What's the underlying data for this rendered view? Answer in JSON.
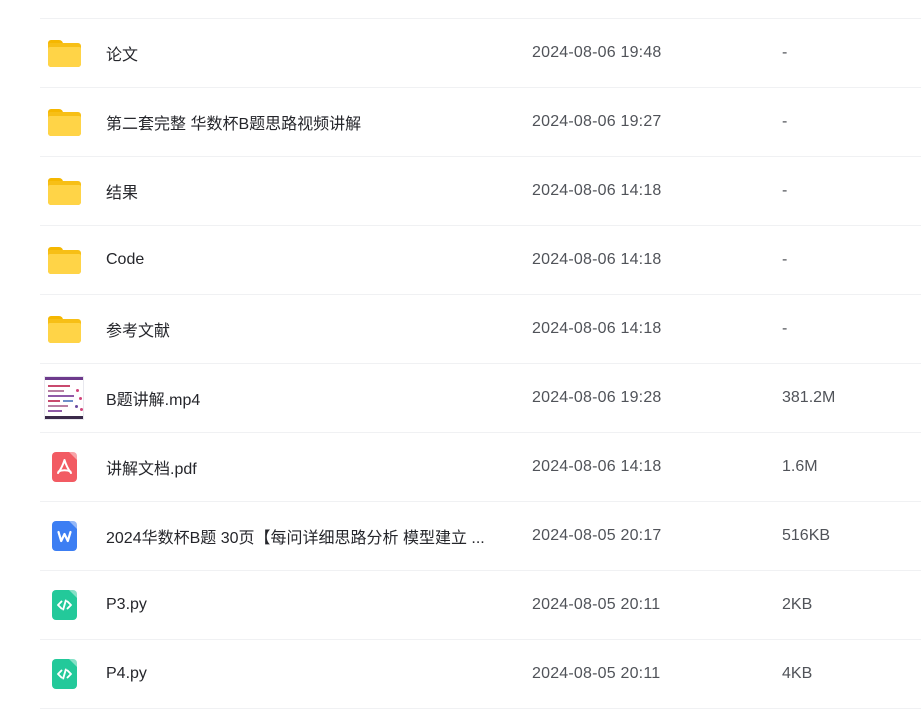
{
  "files": [
    {
      "name": "论文",
      "date": "2024-08-06 19:48",
      "size": "-",
      "icon": "folder-icon"
    },
    {
      "name": "第二套完整 华数杯B题思路视频讲解",
      "date": "2024-08-06 19:27",
      "size": "-",
      "icon": "folder-icon"
    },
    {
      "name": "结果",
      "date": "2024-08-06 14:18",
      "size": "-",
      "icon": "folder-icon"
    },
    {
      "name": "Code",
      "date": "2024-08-06 14:18",
      "size": "-",
      "icon": "folder-icon"
    },
    {
      "name": "参考文献",
      "date": "2024-08-06 14:18",
      "size": "-",
      "icon": "folder-icon"
    },
    {
      "name": "B题讲解.mp4",
      "date": "2024-08-06 19:28",
      "size": "381.2M",
      "icon": "video-thumbnail-icon"
    },
    {
      "name": "讲解文档.pdf",
      "date": "2024-08-06 14:18",
      "size": "1.6M",
      "icon": "pdf-icon"
    },
    {
      "name": "2024华数杯B题 30页【每问详细思路分析 模型建立 ...",
      "date": "2024-08-05 20:17",
      "size": "516KB",
      "icon": "word-doc-icon"
    },
    {
      "name": "P3.py",
      "date": "2024-08-05 20:11",
      "size": "2KB",
      "icon": "code-file-icon"
    },
    {
      "name": "P4.py",
      "date": "2024-08-05 20:11",
      "size": "4KB",
      "icon": "code-file-icon"
    }
  ],
  "colors": {
    "folder": "#ffd447",
    "pdf": "#f25b63",
    "word": "#3c7ef3",
    "code": "#23c99a",
    "text": "#25262b",
    "muted": "#505359"
  }
}
